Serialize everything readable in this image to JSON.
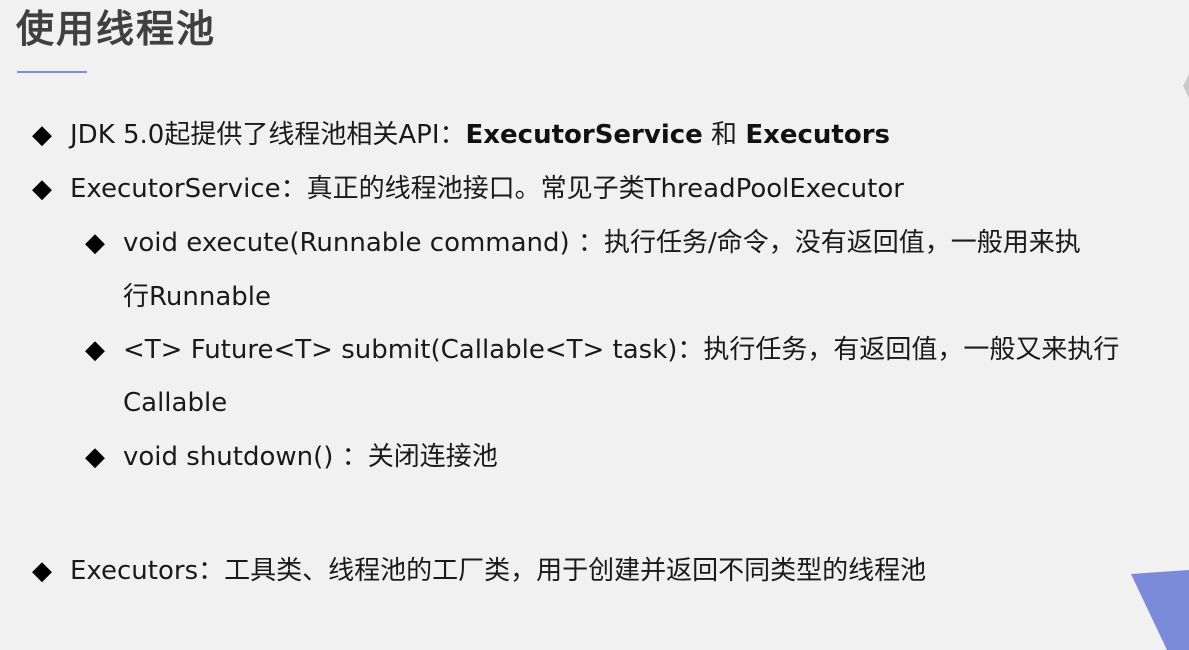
{
  "slide": {
    "title": "使用线程池",
    "accent_color": "#7b8ad9"
  },
  "bullets": [
    {
      "marker": "◆",
      "plain_1": "JDK 5.0起提供了线程池相关API：",
      "bold_1": "ExecutorService",
      "plain_2": " 和 ",
      "bold_2": "Executors"
    },
    {
      "marker": "◆",
      "text": "ExecutorService：真正的线程池接口。常见子类ThreadPoolExecutor"
    },
    {
      "marker": "◆",
      "line1": "void execute(Runnable command) ：执行任务/命令，没有返回值，一般用来执",
      "line2": "行Runnable"
    },
    {
      "marker": "◆",
      "line1": "<T> Future<T> submit(Callable<T> task)：执行任务，有返回值，一般又来执行",
      "line2": "Callable"
    },
    {
      "marker": "◆",
      "text": "void shutdown() ：关闭连接池"
    },
    {
      "marker": "◆",
      "text": "Executors：工具类、线程池的工厂类，用于创建并返回不同类型的线程池"
    }
  ]
}
